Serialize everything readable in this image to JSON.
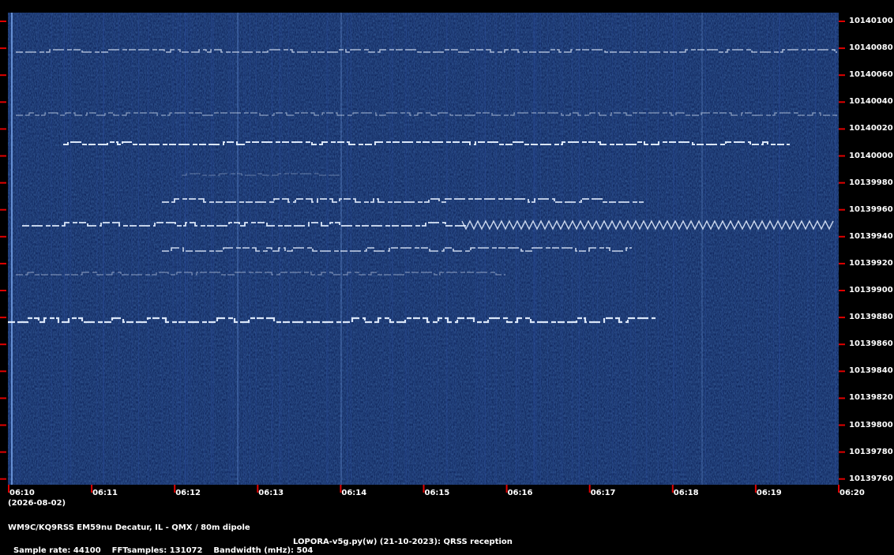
{
  "axes": {
    "frequency_labels": [
      "10140100",
      "10140080",
      "10140060",
      "10140040",
      "10140020",
      "10140000",
      "10139980",
      "10139960",
      "10139940",
      "10139920",
      "10139900",
      "10139880",
      "10139860",
      "10139840",
      "10139820",
      "10139800",
      "10139780",
      "10139760"
    ],
    "time_labels": [
      "06:10",
      "06:11",
      "06:12",
      "06:13",
      "06:14",
      "06:15",
      "06:16",
      "06:17",
      "06:18",
      "06:19",
      "06:20"
    ],
    "date": "(2026-08-02)"
  },
  "footer": {
    "station": "WM9C/KQ9RSS EM59nu Decatur, IL - QMX / 80m dipole",
    "sample_rate": "Sample rate: 44100",
    "fft_samples": "FFTsamples: 131072",
    "bandwidth": "Bandwidth (mHz): 504",
    "software": "LOPORA-v5g.py(w) (21-10-2023): QRSS reception"
  },
  "colors": {
    "background": "#0b1f55",
    "signal": "#e6f0ff",
    "tick": "#e00000"
  }
}
